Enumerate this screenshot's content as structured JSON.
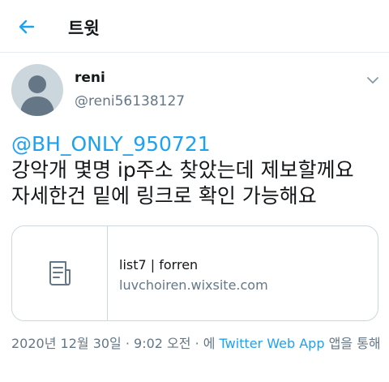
{
  "header": {
    "title": "트윗"
  },
  "user": {
    "name": "reni",
    "handle": "@reni56138127"
  },
  "tweet": {
    "mention": "@BH_ONLY_950721",
    "line1": "강악개 몇명 ip주소 찾았는데 제보할께요",
    "line2": "자세한건 밑에 링크로 확인 가능해요"
  },
  "card": {
    "title": "list7 | forren",
    "domain": "luvchoiren.wixsite.com"
  },
  "meta": {
    "timestamp": "2020년 12월 30일 · 9:02 오전 · 에 ",
    "app": "Twitter Web App",
    "suffix": " 앱을 통해"
  },
  "colors": {
    "accent": "#1da1f2",
    "secondary_text": "#657786",
    "border": "#ccd6dd"
  },
  "icons": {
    "back": "back-arrow-icon",
    "more": "chevron-down-icon",
    "card": "article-icon",
    "avatar": "default-avatar-icon"
  }
}
